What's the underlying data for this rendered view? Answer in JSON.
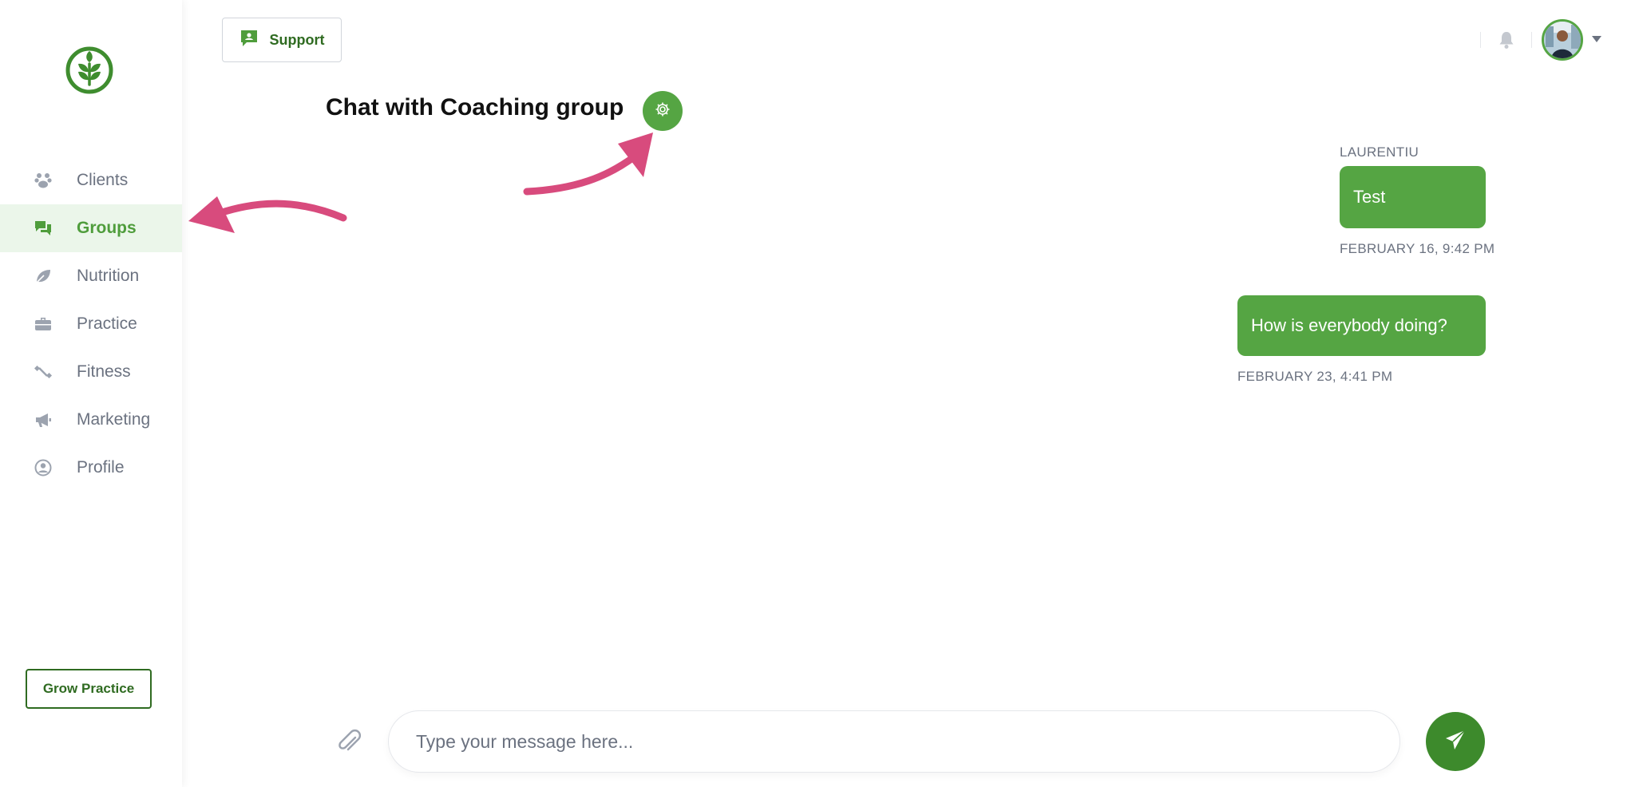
{
  "sidebar": {
    "logo": "leaf-logo",
    "items": [
      {
        "label": "Clients",
        "icon": "paw-icon",
        "active": false
      },
      {
        "label": "Groups",
        "icon": "chat-icon",
        "active": true
      },
      {
        "label": "Nutrition",
        "icon": "leaf-icon",
        "active": false
      },
      {
        "label": "Practice",
        "icon": "briefcase-icon",
        "active": false
      },
      {
        "label": "Fitness",
        "icon": "dumbbell-icon",
        "active": false
      },
      {
        "label": "Marketing",
        "icon": "megaphone-icon",
        "active": false
      },
      {
        "label": "Profile",
        "icon": "user-circle-icon",
        "active": false
      }
    ],
    "grow_button": "Grow Practice"
  },
  "topbar": {
    "support_label": "Support",
    "support_icon": "support-chat-icon",
    "notifications_icon": "bell-icon",
    "avatar_icon": "user-avatar",
    "menu_icon": "caret-down-icon"
  },
  "chat": {
    "title": "Chat with Coaching group",
    "settings_icon": "gear-icon",
    "messages": [
      {
        "sender": "LAURENTIU",
        "text": "Test",
        "time": "FEBRUARY 16, 9:42 PM"
      },
      {
        "sender": "",
        "text": "How is everybody doing?",
        "time": "FEBRUARY 23, 4:41 PM"
      }
    ]
  },
  "composer": {
    "placeholder": "Type your message here...",
    "value": "",
    "attach_icon": "paperclip-icon",
    "send_icon": "paper-plane-icon"
  },
  "colors": {
    "brand_green": "#55a543",
    "dark_green": "#2f6b21",
    "active_bg": "#ebf6ea",
    "annotation_pink": "#d84b7d"
  }
}
